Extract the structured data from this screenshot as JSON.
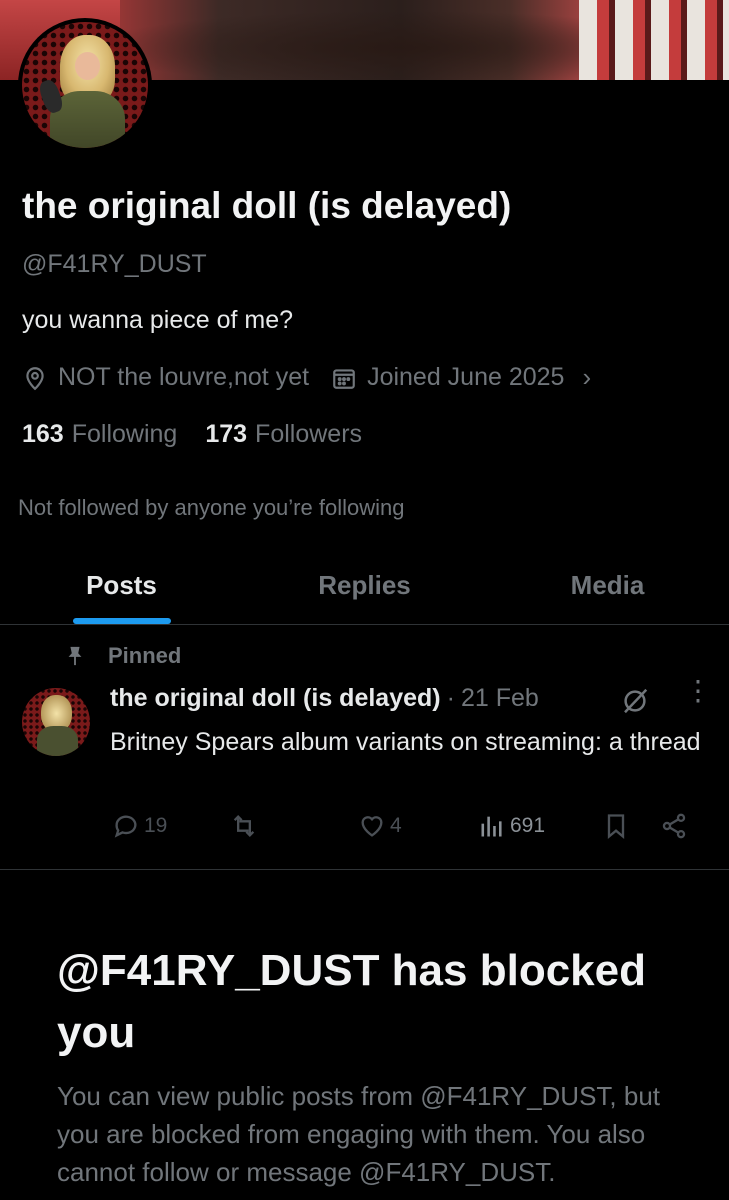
{
  "profile": {
    "display_name": "the original doll (is delayed)",
    "handle": "@F41RY_DUST",
    "bio": "you wanna piece of me?",
    "location": "NOT the louvre,not yet",
    "joined": "Joined June 2025",
    "following_count": "163",
    "following_label": "Following",
    "followers_count": "173",
    "followers_label": "Followers",
    "not_followed": "Not followed by anyone you’re following"
  },
  "tabs": [
    {
      "label": "Posts",
      "active": true
    },
    {
      "label": "Replies",
      "active": false
    },
    {
      "label": "Media",
      "active": false
    }
  ],
  "pinned_post": {
    "pinned_label": "Pinned",
    "author": "the original doll (is delayed)",
    "separator": "·",
    "date": "21 Feb",
    "text": "Britney Spears album variants on streaming: a thread",
    "replies": "19",
    "likes": "4",
    "views": "691"
  },
  "blocked": {
    "title": "@F41RY_DUST has blocked you",
    "description": "You can view public posts from @F41RY_DUST, but you are blocked from engaging with them. You also cannot follow or message @F41RY_DUST."
  },
  "colors": {
    "background": "#000000",
    "text": "#e7e9ea",
    "muted": "#71767b",
    "accent": "#1d9bf0",
    "divider": "#2f3336"
  },
  "icons": {
    "location": "location-pin-icon",
    "calendar": "calendar-icon",
    "pin": "pin-icon",
    "reply": "reply-icon",
    "repost": "repost-icon",
    "like": "heart-icon",
    "views": "views-icon",
    "bookmark": "bookmark-icon",
    "share": "share-icon",
    "grok": "grok-icon",
    "more": "more-icon"
  }
}
